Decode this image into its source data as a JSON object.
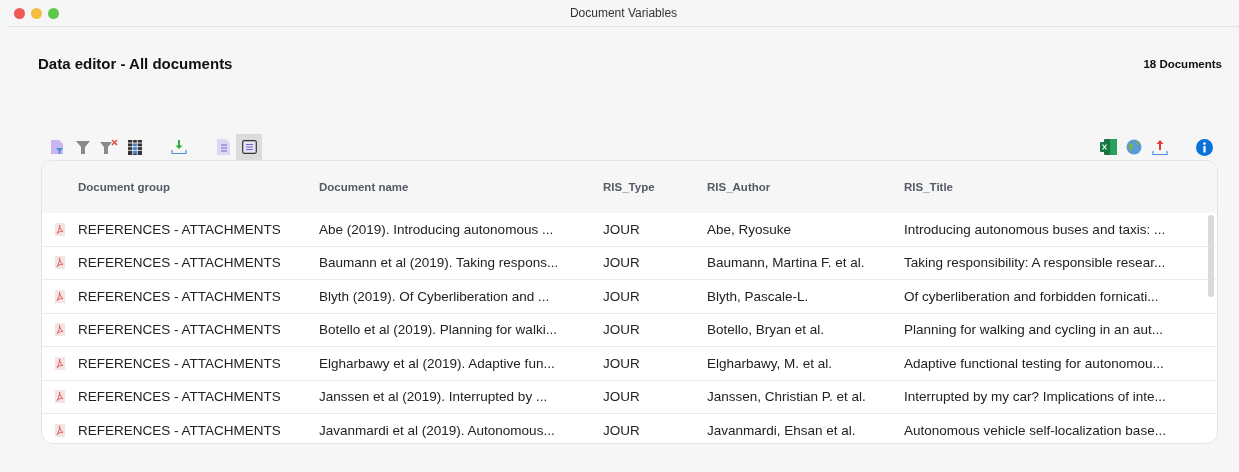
{
  "window": {
    "title": "Document Variables"
  },
  "header": {
    "title": "Data editor - All documents",
    "count": "18 Documents"
  },
  "toolbar": {
    "left": [
      {
        "kind": "doc-filter",
        "selected": false
      },
      {
        "kind": "filter",
        "selected": false
      },
      {
        "kind": "filter-clear",
        "selected": false
      },
      {
        "kind": "table",
        "selected": false
      },
      {
        "kind": "gap"
      },
      {
        "kind": "download",
        "selected": false
      },
      {
        "kind": "gap"
      },
      {
        "kind": "doc-list",
        "selected": false
      },
      {
        "kind": "list-view",
        "selected": true
      }
    ],
    "right": [
      {
        "kind": "excel"
      },
      {
        "kind": "globe"
      },
      {
        "kind": "upload"
      },
      {
        "kind": "gap"
      },
      {
        "kind": "info"
      }
    ]
  },
  "table": {
    "columns": [
      "Document group",
      "Document name",
      "RIS_Type",
      "RIS_Author",
      "RIS_Title"
    ],
    "rows": [
      {
        "kind": "pdf",
        "cells": [
          "REFERENCES - ATTACHMENTS",
          "Abe (2019). Introducing autonomous ...",
          "JOUR",
          "Abe, Ryosuke",
          "Introducing autonomous buses and taxis: ..."
        ]
      },
      {
        "kind": "pdf",
        "cells": [
          "REFERENCES - ATTACHMENTS",
          "Baumann et al (2019). Taking respons...",
          "JOUR",
          "Baumann, Martina F. et al.",
          "Taking responsibility: A responsible resear..."
        ]
      },
      {
        "kind": "pdf",
        "cells": [
          "REFERENCES - ATTACHMENTS",
          "Blyth (2019). Of Cyberliberation and ...",
          "JOUR",
          "Blyth, Pascale-L.",
          "Of cyberliberation and forbidden fornicati..."
        ]
      },
      {
        "kind": "pdf",
        "cells": [
          "REFERENCES - ATTACHMENTS",
          "Botello et al (2019). Planning for walki...",
          "JOUR",
          "Botello, Bryan et al.",
          "Planning for walking and cycling in an aut..."
        ]
      },
      {
        "kind": "pdf",
        "cells": [
          "REFERENCES - ATTACHMENTS",
          "Elgharbawy et al (2019). Adaptive fun...",
          "JOUR",
          "Elgharbawy, M. et al.",
          "Adaptive functional testing for autonomou..."
        ]
      },
      {
        "kind": "pdf",
        "cells": [
          "REFERENCES - ATTACHMENTS",
          "Janssen et al (2019). Interrupted by ...",
          "JOUR",
          "Janssen, Christian P. et al.",
          "Interrupted by my car? Implications of inte..."
        ]
      },
      {
        "kind": "pdf",
        "cells": [
          "REFERENCES - ATTACHMENTS",
          "Javanmardi et al (2019). Autonomous...",
          "JOUR",
          "Javanmardi, Ehsan et al.",
          "Autonomous vehicle self-localization base..."
        ]
      }
    ]
  }
}
